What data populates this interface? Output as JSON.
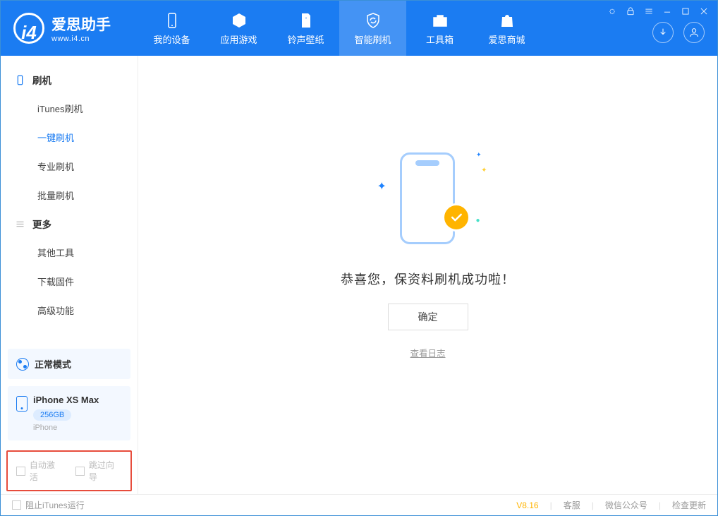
{
  "app": {
    "name": "爱思助手",
    "url": "www.i4.cn"
  },
  "tabs": {
    "device": "我的设备",
    "apps": "应用游戏",
    "ringtone": "铃声壁纸",
    "flash": "智能刷机",
    "toolbox": "工具箱",
    "store": "爱思商城"
  },
  "sidebar": {
    "group_flash": "刷机",
    "items_flash": {
      "itunes": "iTunes刷机",
      "oneclick": "一键刷机",
      "pro": "专业刷机",
      "batch": "批量刷机"
    },
    "group_more": "更多",
    "items_more": {
      "other": "其他工具",
      "firmware": "下载固件",
      "adv": "高级功能"
    },
    "mode": "正常模式",
    "device": {
      "name": "iPhone XS Max",
      "capacity": "256GB",
      "type": "iPhone"
    },
    "cb_autoactivate": "自动激活",
    "cb_skipguide": "跳过向导"
  },
  "main": {
    "success": "恭喜您，保资料刷机成功啦！",
    "ok": "确定",
    "viewlog": "查看日志"
  },
  "status": {
    "block_itunes": "阻止iTunes运行",
    "version": "V8.16",
    "kefu": "客服",
    "wechat": "微信公众号",
    "update": "检查更新"
  }
}
